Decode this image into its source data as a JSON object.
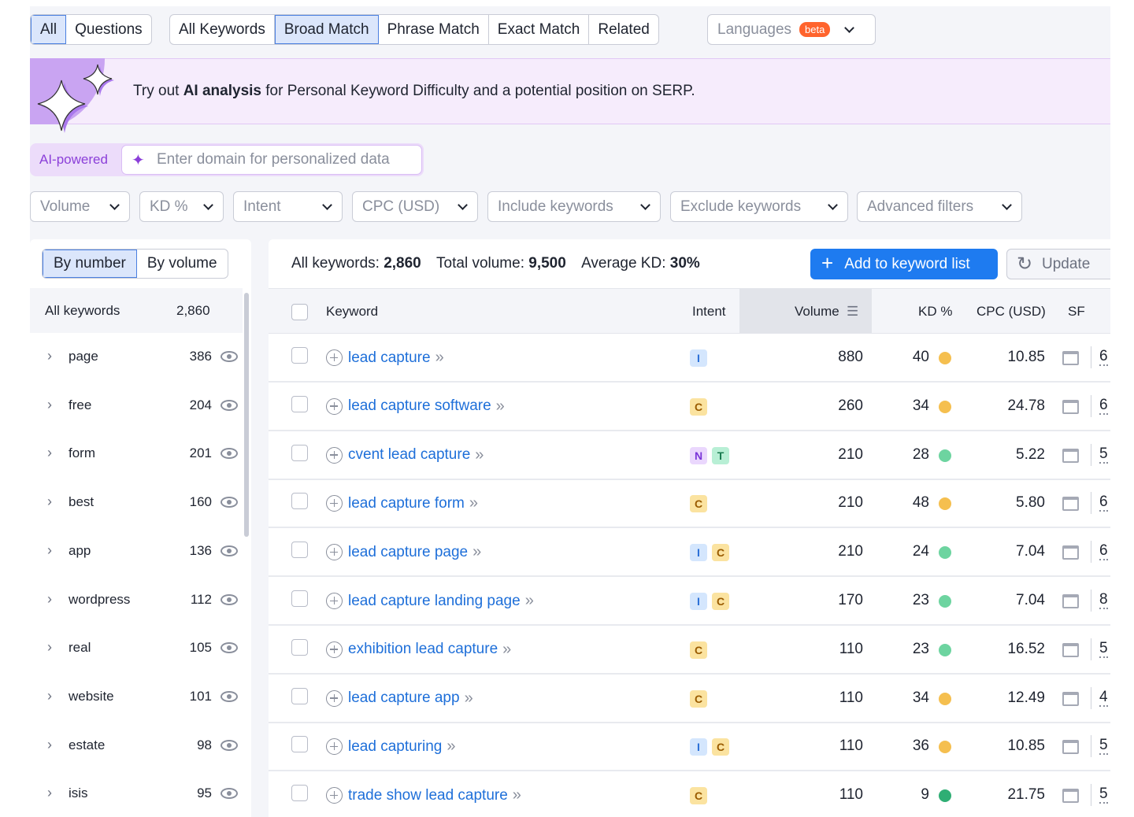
{
  "tabs1": [
    "All",
    "Questions"
  ],
  "tabs2": [
    "All Keywords",
    "Broad Match",
    "Phrase Match",
    "Exact Match",
    "Related"
  ],
  "languages": {
    "label": "Languages",
    "badge": "beta"
  },
  "banner": {
    "pre": "Try out ",
    "bold": "AI analysis",
    "post": " for Personal Keyword Difficulty and a potential position on SERP."
  },
  "ai": {
    "label": "AI-powered",
    "placeholder": "Enter domain for personalized data"
  },
  "filters": [
    "Volume",
    "KD %",
    "Intent",
    "CPC (USD)",
    "Include keywords",
    "Exclude keywords",
    "Advanced filters"
  ],
  "sidebar": {
    "toggle": [
      "By number",
      "By volume"
    ],
    "all_label": "All keywords",
    "all_count": "2,860",
    "items": [
      {
        "label": "page",
        "count": "386"
      },
      {
        "label": "free",
        "count": "204"
      },
      {
        "label": "form",
        "count": "201"
      },
      {
        "label": "best",
        "count": "160"
      },
      {
        "label": "app",
        "count": "136"
      },
      {
        "label": "wordpress",
        "count": "112"
      },
      {
        "label": "real",
        "count": "105"
      },
      {
        "label": "website",
        "count": "101"
      },
      {
        "label": "estate",
        "count": "98"
      },
      {
        "label": "isis",
        "count": "95"
      }
    ]
  },
  "summary": {
    "kw_label": "All keywords: ",
    "kw": "2,860",
    "vol_label": "Total volume: ",
    "vol": "9,500",
    "kd_label": "Average KD: ",
    "kd": "30%"
  },
  "buttons": {
    "add": "Add to keyword list",
    "update": "Update"
  },
  "columns": {
    "keyword": "Keyword",
    "intent": "Intent",
    "volume": "Volume",
    "kd": "KD %",
    "cpc": "CPC (USD)",
    "sf": "SF"
  },
  "colors": {
    "accent": "#1e7bf0",
    "kd_yellow": "#f5bf4f",
    "kd_light_green": "#6dd4a0",
    "kd_green": "#2fae74"
  },
  "rows": [
    {
      "keyword": "lead capture",
      "intent": [
        "I"
      ],
      "volume": "880",
      "kd": "40",
      "kd_color": "#f5bf4f",
      "cpc": "10.85",
      "sf": "6"
    },
    {
      "keyword": "lead capture software",
      "intent": [
        "C"
      ],
      "volume": "260",
      "kd": "34",
      "kd_color": "#f5bf4f",
      "cpc": "24.78",
      "sf": "6"
    },
    {
      "keyword": "cvent lead capture",
      "intent": [
        "N",
        "T"
      ],
      "volume": "210",
      "kd": "28",
      "kd_color": "#6dd4a0",
      "cpc": "5.22",
      "sf": "5"
    },
    {
      "keyword": "lead capture form",
      "intent": [
        "C"
      ],
      "volume": "210",
      "kd": "48",
      "kd_color": "#f5bf4f",
      "cpc": "5.80",
      "sf": "6"
    },
    {
      "keyword": "lead capture page",
      "intent": [
        "I",
        "C"
      ],
      "volume": "210",
      "kd": "24",
      "kd_color": "#6dd4a0",
      "cpc": "7.04",
      "sf": "6"
    },
    {
      "keyword": "lead capture landing page",
      "intent": [
        "I",
        "C"
      ],
      "volume": "170",
      "kd": "23",
      "kd_color": "#6dd4a0",
      "cpc": "7.04",
      "sf": "8"
    },
    {
      "keyword": "exhibition lead capture",
      "intent": [
        "C"
      ],
      "volume": "110",
      "kd": "23",
      "kd_color": "#6dd4a0",
      "cpc": "16.52",
      "sf": "5"
    },
    {
      "keyword": "lead capture app",
      "intent": [
        "C"
      ],
      "volume": "110",
      "kd": "34",
      "kd_color": "#f5bf4f",
      "cpc": "12.49",
      "sf": "4"
    },
    {
      "keyword": "lead capturing",
      "intent": [
        "I",
        "C"
      ],
      "volume": "110",
      "kd": "36",
      "kd_color": "#f5bf4f",
      "cpc": "10.85",
      "sf": "5"
    },
    {
      "keyword": "trade show lead capture",
      "intent": [
        "C"
      ],
      "volume": "110",
      "kd": "9",
      "kd_color": "#2fae74",
      "cpc": "21.75",
      "sf": "5"
    }
  ]
}
